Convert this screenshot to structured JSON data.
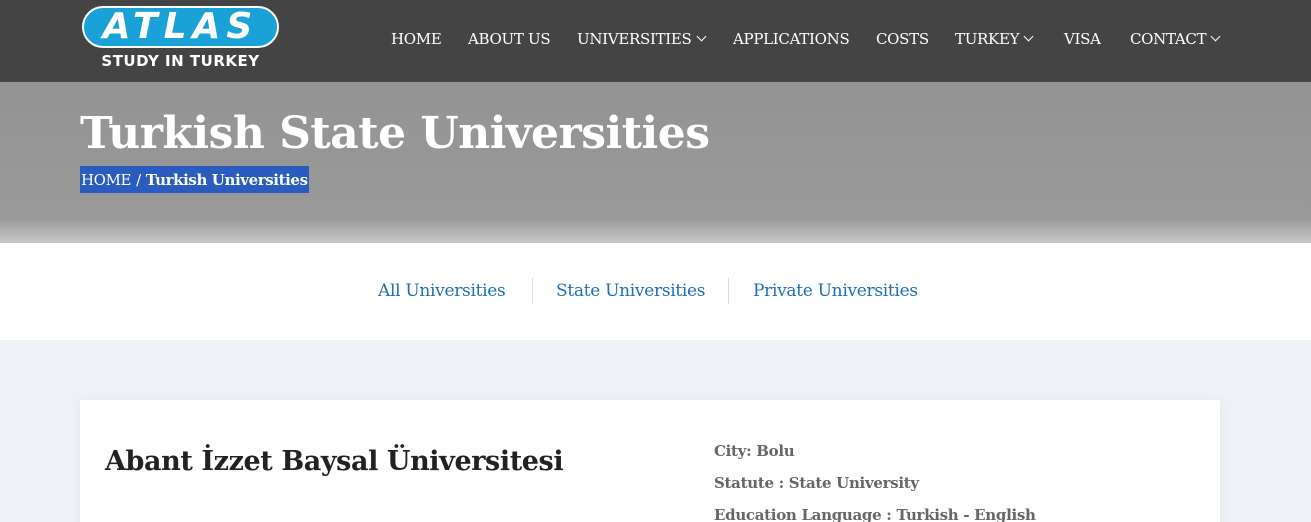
{
  "brand": {
    "logo_word": "ATLAS",
    "tagline": "STUDY IN TURKEY",
    "pill_color": "#1aa1d6"
  },
  "nav": {
    "items": [
      {
        "label": "HOME",
        "has_dropdown": false
      },
      {
        "label": "ABOUT US",
        "has_dropdown": false
      },
      {
        "label": "UNIVERSITIES",
        "has_dropdown": true
      },
      {
        "label": "APPLICATIONS",
        "has_dropdown": false
      },
      {
        "label": "COSTS",
        "has_dropdown": false
      },
      {
        "label": "TURKEY",
        "has_dropdown": true
      },
      {
        "label": "VISA",
        "has_dropdown": false
      },
      {
        "label": "CONTACT",
        "has_dropdown": true
      }
    ],
    "dropdown_icon": "chevron-down-icon"
  },
  "hero": {
    "title": "Turkish State Universities",
    "breadcrumb": {
      "home": "HOME",
      "separator": "/",
      "current": "Turkish Universities"
    },
    "highlight_color": "#2a5bbf"
  },
  "filter_tabs": [
    {
      "label": "All Universities"
    },
    {
      "label": "State Universities"
    },
    {
      "label": "Private Universities"
    }
  ],
  "university": {
    "name": "Abant İzzet Baysal Üniversitesi",
    "city_label": "City:",
    "city": "Bolu",
    "statute_label": "Statute :",
    "statute": "State University",
    "language_label": "Education Language :",
    "language": "Turkish - English"
  },
  "colors": {
    "topbar": "#444444",
    "link": "#1d6fb8",
    "page_bg": "#eef2f7"
  }
}
